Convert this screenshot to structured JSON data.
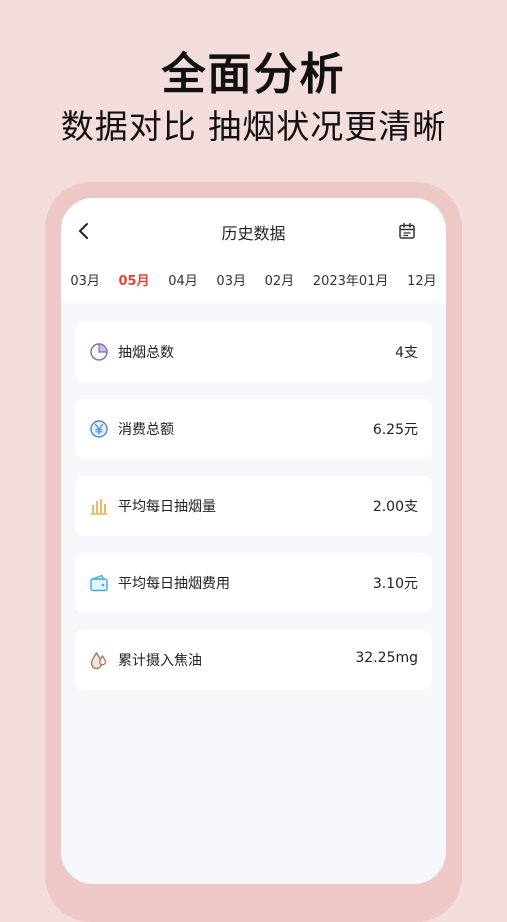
{
  "promo": {
    "title": "全面分析",
    "subtitle": "数据对比 抽烟状况更清晰"
  },
  "header": {
    "title": "历史数据",
    "back_icon": "chevron-left-icon",
    "calendar_icon": "calendar-icon"
  },
  "months": [
    "03月",
    "05月",
    "04月",
    "03月",
    "02月",
    "2023年01月",
    "12月"
  ],
  "active_month": "05月",
  "accent_color": "#e0453a",
  "stats": [
    {
      "label": "抽烟总数",
      "value": "4支",
      "icon": "pie-chart-icon"
    },
    {
      "label": "消费总额",
      "value": "6.25元",
      "icon": "yen-coin-icon"
    },
    {
      "label": "平均每日抽烟量",
      "value": "2.00支",
      "icon": "bar-chart-icon"
    },
    {
      "label": "平均每日抽烟费用",
      "value": "3.10元",
      "icon": "wallet-icon"
    },
    {
      "label": "累计摄入焦油",
      "value": "32.25mg",
      "icon": "droplet-icon"
    }
  ]
}
